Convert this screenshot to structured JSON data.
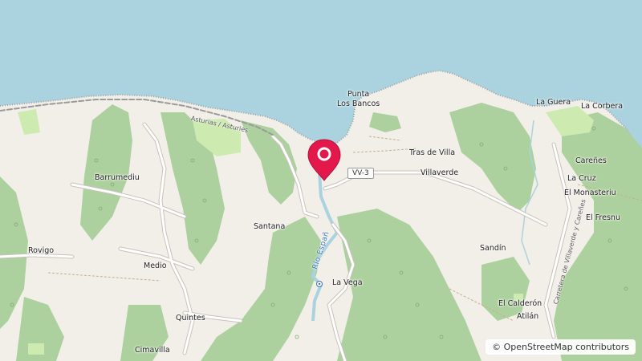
{
  "map": {
    "attribution": "© OpenStreetMap contributors",
    "marker": {
      "type": "location-pin",
      "color": "#e3194c"
    },
    "colors": {
      "water": "#aad3df",
      "land": "#f2efe9",
      "forest": "#add19e",
      "meadow": "#cdebb0",
      "road": "#ffffff",
      "river": "#aad3df"
    },
    "places": [
      {
        "id": "punta-los-bancos",
        "text": "Punta\nLos Bancos"
      },
      {
        "id": "la-guera",
        "text": "La Guera"
      },
      {
        "id": "la-corbera",
        "text": "La Corbera"
      },
      {
        "id": "barrumediu",
        "text": "Barrumediu"
      },
      {
        "id": "tras-de-villa",
        "text": "Tras de Villa"
      },
      {
        "id": "villaverde",
        "text": "Villaverde"
      },
      {
        "id": "carenes",
        "text": "Careñes"
      },
      {
        "id": "la-cruz",
        "text": "La Cruz"
      },
      {
        "id": "el-monasteriu",
        "text": "El Monasteriu"
      },
      {
        "id": "el-fresnu",
        "text": "El Fresnu"
      },
      {
        "id": "santana",
        "text": "Santana"
      },
      {
        "id": "rovigo",
        "text": "Rovigo"
      },
      {
        "id": "medio",
        "text": "Medio"
      },
      {
        "id": "sandin",
        "text": "Sandín"
      },
      {
        "id": "la-vega",
        "text": "La Vega"
      },
      {
        "id": "quintes",
        "text": "Quintes"
      },
      {
        "id": "el-calderon",
        "text": "El Calderón"
      },
      {
        "id": "atilan",
        "text": "Atilán"
      },
      {
        "id": "cimavilla",
        "text": "Cimavilla"
      }
    ],
    "roads": {
      "coastal": "Asturias / Asturies",
      "shield": "VV-3",
      "carretera": "Carretera de Villaverde y Careñes"
    },
    "river": "Río Españ"
  }
}
